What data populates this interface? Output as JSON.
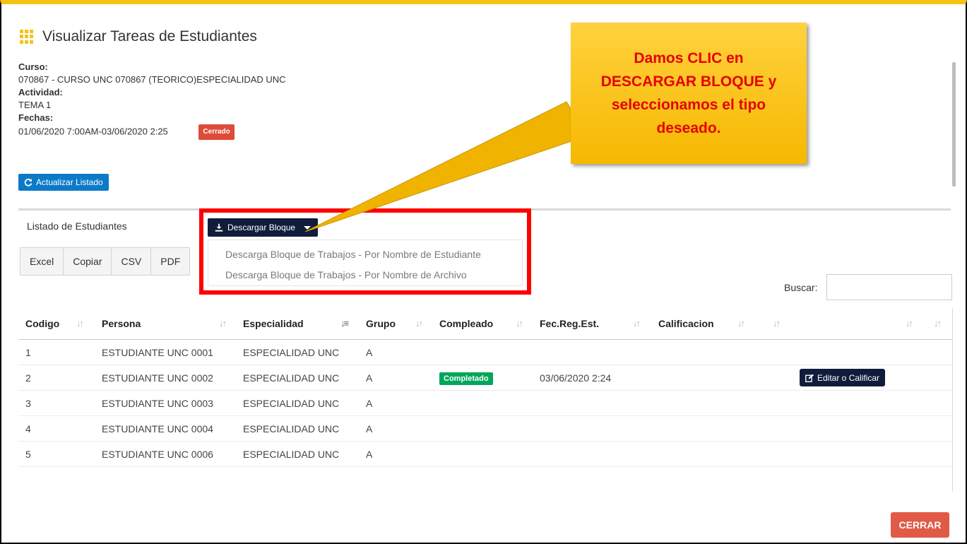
{
  "header": {
    "title": "Visualizar Tareas de Estudiantes"
  },
  "info": {
    "curso_label": "Curso:",
    "curso_value": "070867 - CURSO UNC 070867 (TEORICO)ESPECIALIDAD UNC",
    "actividad_label": "Actividad:",
    "actividad_value": "TEMA 1",
    "fechas_label": "Fechas:",
    "fechas_value": "01/06/2020 7:00AM-03/06/2020 2:25",
    "status_badge": "Cerrado"
  },
  "toolbar": {
    "actualizar_label": "Actualizar Listado"
  },
  "tabs": {
    "listado_label": "Listado de Estudiantes"
  },
  "descargar": {
    "button_label": "Descargar Bloque",
    "options": [
      "Descarga Bloque de Trabajos - Por Nombre de Estudiante",
      "Descarga Bloque de Trabajos - Por Nombre de Archivo"
    ]
  },
  "export_buttons": [
    "Excel",
    "Copiar",
    "CSV",
    "PDF"
  ],
  "search": {
    "label": "Buscar:",
    "value": ""
  },
  "table": {
    "columns": [
      "Codigo",
      "Persona",
      "Especialidad",
      "Grupo",
      "Compleado",
      "Fec.Reg.Est.",
      "Calificacion",
      "",
      ""
    ],
    "rows": [
      {
        "codigo": "1",
        "persona": "ESTUDIANTE UNC 0001",
        "especialidad": "ESPECIALIDAD UNC",
        "grupo": "A",
        "completado": "",
        "fecha": "",
        "accion": ""
      },
      {
        "codigo": "2",
        "persona": "ESTUDIANTE UNC 0002",
        "especialidad": "ESPECIALIDAD UNC",
        "grupo": "A",
        "completado": "Completado",
        "fecha": "03/06/2020 2:24",
        "accion": "Editar o Calificar"
      },
      {
        "codigo": "3",
        "persona": "ESTUDIANTE UNC 0003",
        "especialidad": "ESPECIALIDAD UNC",
        "grupo": "A",
        "completado": "",
        "fecha": "",
        "accion": ""
      },
      {
        "codigo": "4",
        "persona": "ESTUDIANTE UNC 0004",
        "especialidad": "ESPECIALIDAD UNC",
        "grupo": "A",
        "completado": "",
        "fecha": "",
        "accion": ""
      },
      {
        "codigo": "5",
        "persona": "ESTUDIANTE UNC 0006",
        "especialidad": "ESPECIALIDAD UNC",
        "grupo": "A",
        "completado": "",
        "fecha": "",
        "accion": ""
      }
    ]
  },
  "footer": {
    "cerrar_label": "CERRAR"
  },
  "callout": {
    "lines": [
      "Damos CLIC en",
      "DESCARGAR BLOQUE y",
      "seleccionamos el tipo",
      "deseado."
    ]
  },
  "colors": {
    "accent_yellow": "#f3c316",
    "primary_blue": "#0d7ac8",
    "navy": "#0f1d3b",
    "danger": "#dd4b39",
    "success": "#00a65a",
    "highlight_red": "#ff0000",
    "callout_text": "#e60000"
  },
  "icons": {
    "title": "grid-icon",
    "actualizar": "refresh-icon",
    "descargar": "download-icon",
    "editar": "edit-icon",
    "sort": "sort-arrows-icon"
  }
}
